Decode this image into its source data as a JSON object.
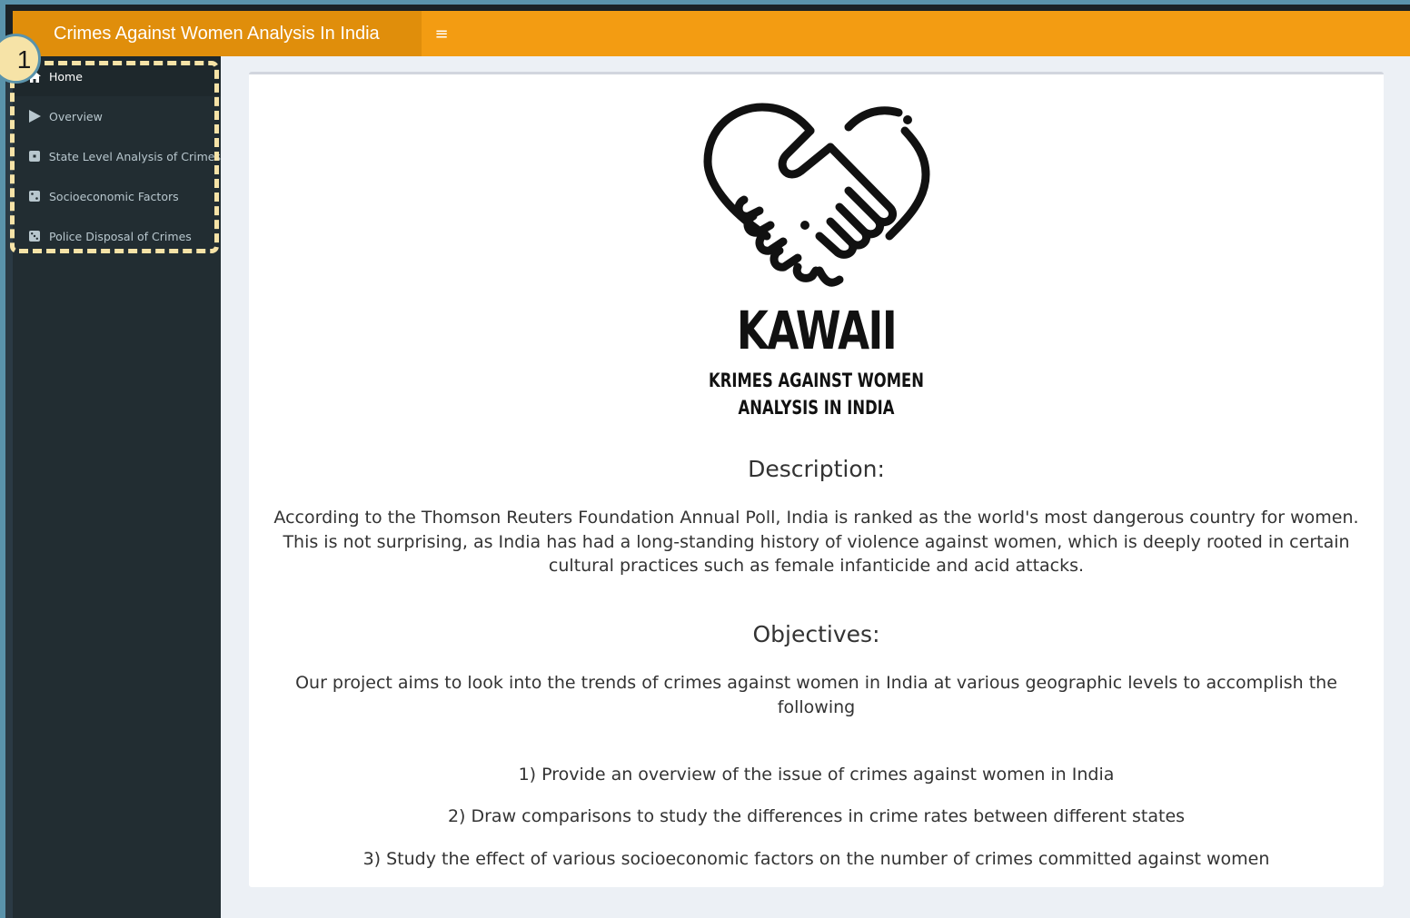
{
  "header": {
    "title": "Crimes Against Women Analysis In India",
    "toggle_icon": "hamburger-icon",
    "accent_color": "#f39c12"
  },
  "sidebar": {
    "items": [
      {
        "label": "Home",
        "icon": "home-icon",
        "active": true
      },
      {
        "label": "Overview",
        "icon": "play-icon",
        "active": false
      },
      {
        "label": "State Level Analysis of Crimes",
        "icon": "square-icon",
        "active": false
      },
      {
        "label": "Socioeconomic Factors",
        "icon": "dice-icon",
        "active": false
      },
      {
        "label": "Police Disposal of Crimes",
        "icon": "dice-icon",
        "active": false
      }
    ]
  },
  "annotation": {
    "callout_number": "1",
    "highlight_color": "#f6e3a7"
  },
  "main": {
    "logo": {
      "icon": "handshake-heart-icon",
      "title": "KAWAII",
      "subtitle_line1": "KRIMES AGAINST WOMEN",
      "subtitle_line2": "ANALYSIS IN INDIA"
    },
    "description_heading": "Description:",
    "description_text": "According to the Thomson Reuters Foundation Annual Poll, India is ranked as the world's most dangerous country for women. This is not surprising, as India has had a long-standing history of violence against women, which is deeply rooted in certain cultural practices such as female infanticide and acid attacks.",
    "objectives_heading": "Objectives:",
    "objectives_intro": "Our project aims to look into the trends of crimes against women in India at various geographic levels to accomplish the following",
    "objectives": [
      "1) Provide an overview of the issue of crimes against women in India",
      "2) Draw comparisons to study the differences in crime rates between different states",
      "3) Study the effect of various socioeconomic factors on the number of crimes committed against women"
    ]
  }
}
